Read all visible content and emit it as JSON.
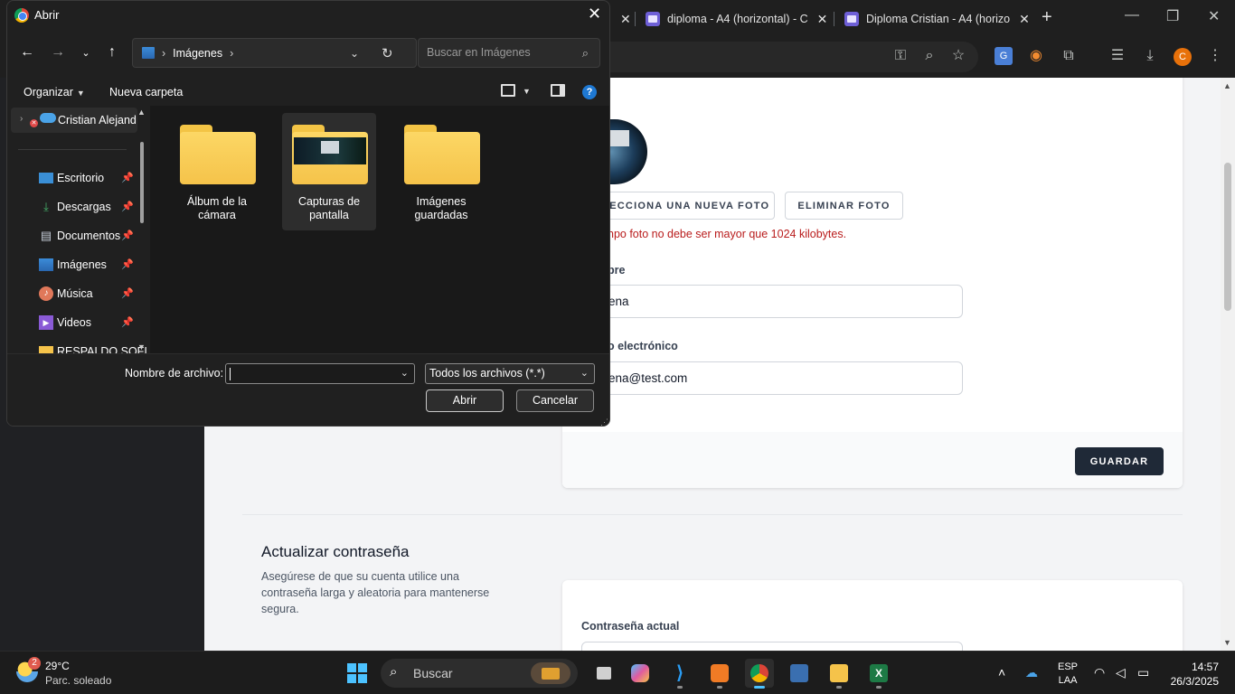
{
  "browser": {
    "tabs": [
      {
        "label": "diploma - A4 (horizontal) - C"
      },
      {
        "label": "Diploma Cristian - A4 (horizo"
      }
    ],
    "profile_initial": "C"
  },
  "page": {
    "buttons": {
      "select_photo": "ELECCIONA UNA NUEVA FOTO",
      "delete_photo": "ELIMINAR FOTO",
      "save": "GUARDAR"
    },
    "photo_error": "npo foto no debe ser mayor que 1024 kilobytes.",
    "name_label": "bre",
    "name_value": "ena",
    "email_label": "o electrónico",
    "email_value": "ena@test.com",
    "password_section": {
      "title": "Actualizar contraseña",
      "description": "Asegúrese de que su cuenta utilice una contraseña larga y aleatoria para mantenerse segura.",
      "current_password_label": "Contraseña actual"
    }
  },
  "dialog": {
    "title": "Abrir",
    "address": {
      "location": "Imágenes"
    },
    "search_placeholder": "Buscar en Imágenes",
    "commands": {
      "organize": "Organizar",
      "new_folder": "Nueva carpeta"
    },
    "nav": {
      "cloud_item": "Cristian Alejand",
      "items": [
        {
          "label": "Escritorio",
          "icon": "desktop-icon"
        },
        {
          "label": "Descargas",
          "icon": "download-icon"
        },
        {
          "label": "Documentos",
          "icon": "document-icon"
        },
        {
          "label": "Imágenes",
          "icon": "pictures-icon"
        },
        {
          "label": "Música",
          "icon": "music-icon"
        },
        {
          "label": "Videos",
          "icon": "video-icon"
        },
        {
          "label": "RESPALDO SOFI",
          "icon": "folder-icon"
        }
      ]
    },
    "folders": [
      {
        "line1": "Álbum de la",
        "line2": "cámara"
      },
      {
        "line1": "Capturas de",
        "line2": "pantalla"
      },
      {
        "line1": "Imágenes",
        "line2": "guardadas"
      }
    ],
    "filename_label": "Nombre de archivo:",
    "filename_value": "",
    "file_filter": "Todos los archivos (*.*)",
    "open_button": "Abrir",
    "cancel_button": "Cancelar"
  },
  "taskbar": {
    "weather": {
      "temp": "29°C",
      "condition": "Parc. soleado",
      "badge": "2"
    },
    "search_placeholder": "Buscar",
    "language": {
      "line1": "ESP",
      "line2": "LAA"
    },
    "time": "14:57",
    "date": "26/3/2025"
  },
  "colors": {
    "accent": "#4cc2ff",
    "error": "#b91c1c",
    "dark_button": "#1f2937"
  }
}
